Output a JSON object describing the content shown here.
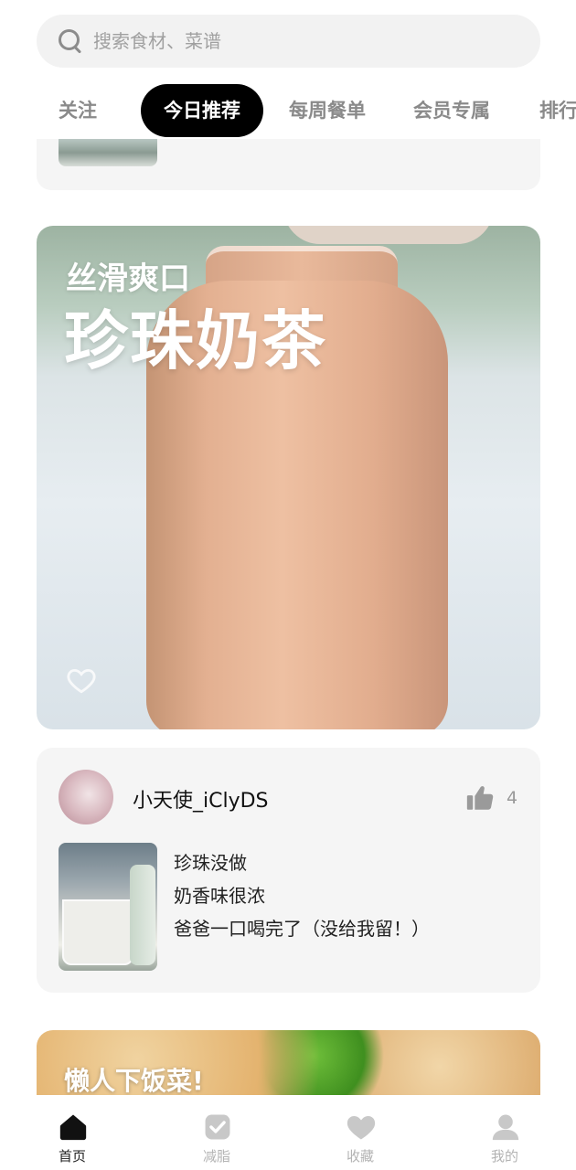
{
  "search": {
    "placeholder": "搜索食材、菜谱"
  },
  "tabs": [
    {
      "label": "关注",
      "active": false
    },
    {
      "label": "今日推荐",
      "active": true
    },
    {
      "label": "每周餐单",
      "active": false
    },
    {
      "label": "会员专属",
      "active": false
    },
    {
      "label": "排行",
      "active": false
    }
  ],
  "hero": {
    "subtitle": "丝滑爽口",
    "title": "珍珠奶茶"
  },
  "comment": {
    "username": "小天使_iClyDS",
    "likes": "4",
    "lines": [
      "珍珠没做",
      "奶香味很浓",
      "爸爸一口喝完了（没给我留！）"
    ]
  },
  "next_card": {
    "title": "懒人下饭菜!"
  },
  "bottom_nav": [
    {
      "label": "首页",
      "icon": "home-icon",
      "active": true
    },
    {
      "label": "减脂",
      "icon": "diet-shield-icon",
      "active": false
    },
    {
      "label": "收藏",
      "icon": "heart-icon",
      "active": false
    },
    {
      "label": "我的",
      "icon": "profile-icon",
      "active": false
    }
  ],
  "colors": {
    "active_tab_bg": "#000000",
    "card_bg": "#f5f5f5",
    "muted_text": "#8a8a8a"
  }
}
